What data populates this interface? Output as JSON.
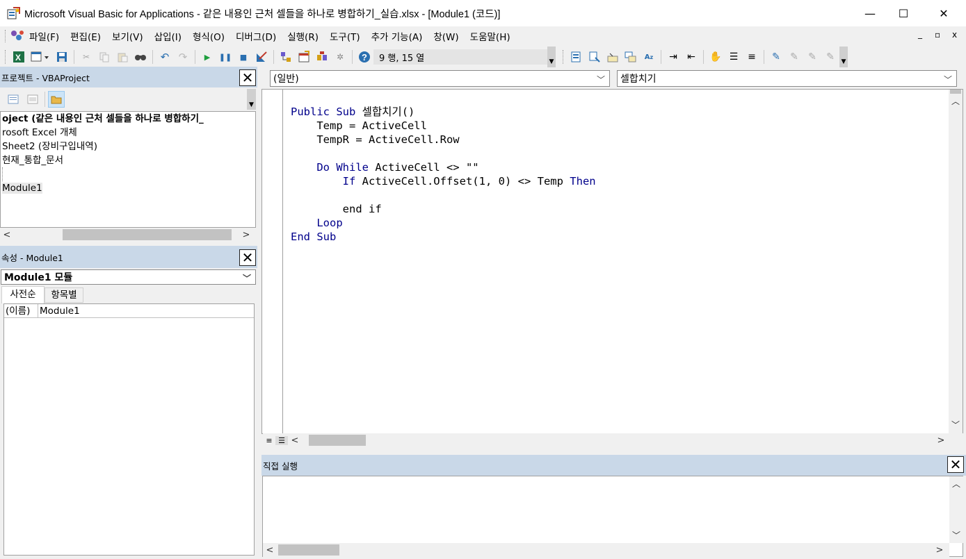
{
  "window": {
    "title": "Microsoft Visual Basic for Applications - 같은 내용인 근처 셀들을 하나로 병합하기_실습.xlsx - [Module1 (코드)]",
    "minimize": "—",
    "maximize": "☐",
    "close": "✕"
  },
  "menu": {
    "items": [
      "파일(F)",
      "편집(E)",
      "보기(V)",
      "삽입(I)",
      "형식(O)",
      "디버그(D)",
      "실행(R)",
      "도구(T)",
      "추가 기능(A)",
      "창(W)",
      "도움말(H)"
    ],
    "doc_min": "_",
    "doc_restore": "▫",
    "doc_close": "x"
  },
  "toolbar": {
    "position": "9 행, 15 열"
  },
  "project_panel": {
    "title": "프로젝트 - VBAProject",
    "close": "✕",
    "tree": [
      "oject (같은 내용인 근처 셀들을 하나로 병합하기_",
      "rosoft Excel 개체",
      "Sheet2 (장비구입내역)",
      "현재_통합_문서",
      "",
      "Module1"
    ]
  },
  "properties_panel": {
    "title": "속성 - Module1",
    "close": "✕",
    "object_select": "Module1 모듈",
    "tabs": [
      "사전순",
      "항목별"
    ],
    "rows": [
      {
        "name": "(이름)",
        "value": "Module1"
      }
    ]
  },
  "code_window": {
    "object_dropdown": "(일반)",
    "procedure_dropdown": "셀합치기",
    "lines": [
      {
        "indent": "",
        "parts": [
          [
            "kw",
            "Public Sub "
          ],
          [
            "t",
            "셀합치기()"
          ]
        ]
      },
      {
        "indent": "    ",
        "parts": [
          [
            "t",
            "Temp = ActiveCell"
          ]
        ]
      },
      {
        "indent": "    ",
        "parts": [
          [
            "t",
            "TempR = ActiveCell.Row"
          ]
        ]
      },
      {
        "indent": "",
        "parts": []
      },
      {
        "indent": "    ",
        "parts": [
          [
            "kw",
            "Do While "
          ],
          [
            "t",
            "ActiveCell <> \"\""
          ]
        ]
      },
      {
        "indent": "        ",
        "parts": [
          [
            "kw",
            "If "
          ],
          [
            "t",
            "ActiveCell.Offset(1, 0) <> Temp "
          ],
          [
            "kw",
            "Then"
          ]
        ]
      },
      {
        "indent": "",
        "parts": []
      },
      {
        "indent": "        ",
        "parts": [
          [
            "t",
            "end if"
          ]
        ]
      },
      {
        "indent": "    ",
        "parts": [
          [
            "kw",
            "Loop"
          ]
        ]
      },
      {
        "indent": "",
        "parts": [
          [
            "kw",
            "End Sub"
          ]
        ]
      }
    ]
  },
  "immediate_panel": {
    "title": "직접 실행",
    "close": "✕"
  },
  "colors": {
    "panel_title_bg": "#c9d8e8",
    "keyword": "#00008b"
  }
}
